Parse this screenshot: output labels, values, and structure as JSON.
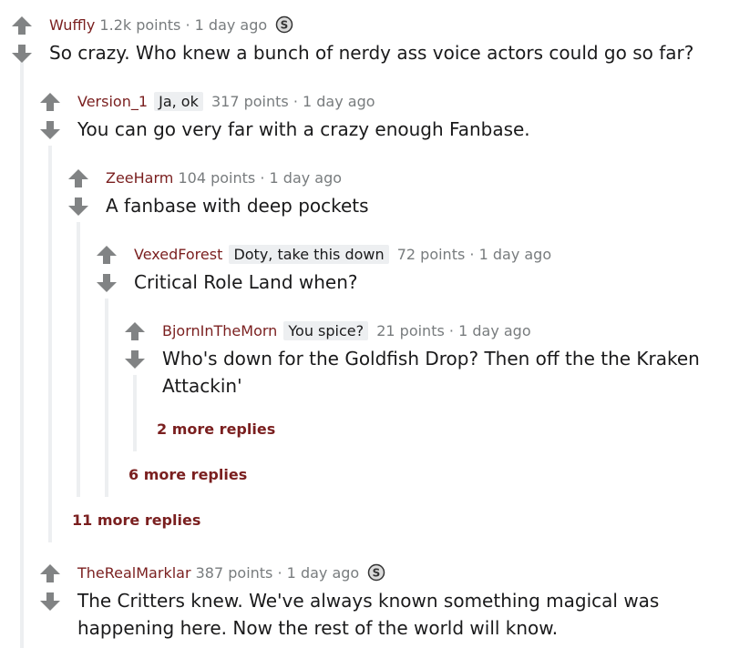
{
  "comments": [
    {
      "author": "Wuffly",
      "flair": "",
      "points": "1.2k points",
      "sep": "·",
      "time": "1 day ago",
      "has_award": true,
      "award_icon": "silver-award-icon",
      "body_lines": [
        "So crazy. Who knew a bunch of nerdy ass voice actors could go so far?"
      ]
    },
    {
      "author": "Version_1",
      "flair": "Ja, ok",
      "points": "317 points",
      "sep": "·",
      "time": "1 day ago",
      "has_award": false,
      "body_lines": [
        "You can go very far with a crazy enough Fanbase."
      ]
    },
    {
      "author": "ZeeHarm",
      "flair": "",
      "points": "104 points",
      "sep": "·",
      "time": "1 day ago",
      "has_award": false,
      "body_lines": [
        "A fanbase with deep pockets"
      ]
    },
    {
      "author": "VexedForest",
      "flair": "Doty, take this down",
      "points": "72 points",
      "sep": "·",
      "time": "1 day ago",
      "has_award": false,
      "body_lines": [
        "Critical Role Land when?"
      ]
    },
    {
      "author": "BjornInTheMorn",
      "flair": "You spice?",
      "points": "21 points",
      "sep": "·",
      "time": "1 day ago",
      "has_award": false,
      "body_lines": [
        "Who's down for the Goldfish Drop? Then off the the Kraken",
        "Attackin'"
      ]
    },
    {
      "author": "TheRealMarklar",
      "flair": "",
      "points": "387 points",
      "sep": "·",
      "time": "1 day ago",
      "has_award": true,
      "award_icon": "silver-award-icon",
      "body_lines": [
        "The Critters knew. We've always known something magical was",
        "happening here. Now the rest of the world will know."
      ]
    }
  ],
  "more_replies": [
    "2 more replies",
    "6 more replies",
    "11 more replies"
  ],
  "colors": {
    "author": "#7a1f1f",
    "meta": "#787c7e",
    "arrow": "#818384",
    "thread_line": "#edeff1",
    "flair_bg": "#edeff1"
  },
  "icons": {
    "upvote": "upvote-arrow-icon",
    "downvote": "downvote-arrow-icon"
  }
}
